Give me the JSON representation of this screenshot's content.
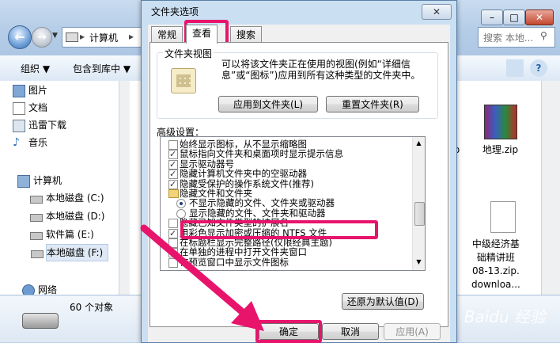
{
  "explorer": {
    "breadcrumb": "计算机",
    "search_placeholder": "搜索 本地...",
    "toolbar": {
      "organize": "组织 ▼",
      "include": "包含到库中 ▼"
    },
    "nav": {
      "libraries": [
        "图片",
        "文档",
        "迅雷下载",
        "音乐"
      ],
      "computer": "计算机",
      "drives": [
        "本地磁盘 (C:)",
        "本地磁盘 (D:)",
        "软件篇 (E:)",
        "本地磁盘 (F:)"
      ],
      "network": "网络"
    },
    "files": {
      "zip_left": "zip",
      "zip1": "地理.zip",
      "p_left": "p",
      "zip2_lines": [
        "中级经济基",
        "础精讲班",
        "08-13.zip.",
        "downloa..."
      ]
    },
    "details": {
      "count": "60 个对象"
    }
  },
  "dialog": {
    "title": "文件夹选项",
    "close": "✕",
    "tabs": [
      "常规",
      "查看",
      "搜索"
    ],
    "folder_view": {
      "label": "文件夹视图",
      "description": "可以将该文件夹正在使用的视图(例如“详细信息”或“图标”)应用到所有这种类型的文件夹中。",
      "apply_btn": "应用到文件夹(L)",
      "reset_btn": "重置文件夹(R)"
    },
    "advanced": {
      "label": "高级设置：",
      "items": [
        {
          "type": "checkbox",
          "checked": false,
          "label": "始终显示图标，从不显示缩略图"
        },
        {
          "type": "checkbox",
          "checked": true,
          "label": "鼠标指向文件夹和桌面项时显示提示信息"
        },
        {
          "type": "checkbox",
          "checked": true,
          "label": "显示驱动器号"
        },
        {
          "type": "checkbox",
          "checked": true,
          "label": "隐藏计算机文件夹中的空驱动器"
        },
        {
          "type": "checkbox",
          "checked": true,
          "label": "隐藏受保护的操作系统文件(推荐)"
        },
        {
          "type": "folder",
          "label": "隐藏文件和文件夹"
        },
        {
          "type": "radio",
          "checked": true,
          "label": "不显示隐藏的文件、文件夹或驱动器"
        },
        {
          "type": "radio",
          "checked": false,
          "label": "显示隐藏的文件、文件夹和驱动器"
        },
        {
          "type": "checkbox",
          "checked": false,
          "label": "隐藏已知文件类型的扩展名"
        },
        {
          "type": "checkbox",
          "checked": true,
          "label": "用彩色显示加密或压缩的 NTFS 文件"
        },
        {
          "type": "checkbox",
          "checked": false,
          "label": "在标题栏显示完整路径(仅限经典主题)"
        },
        {
          "type": "checkbox",
          "checked": false,
          "label": "在单独的进程中打开文件夹窗口"
        },
        {
          "type": "checkbox",
          "checked": false,
          "label": "在预览窗口中显示文件图标"
        }
      ],
      "restore_btn": "还原为默认值(D)"
    },
    "buttons": {
      "ok": "确定",
      "cancel": "取消",
      "apply": "应用(A)"
    }
  },
  "watermark": "Baidu 经验",
  "colors": {
    "highlight": "#e8146c"
  }
}
